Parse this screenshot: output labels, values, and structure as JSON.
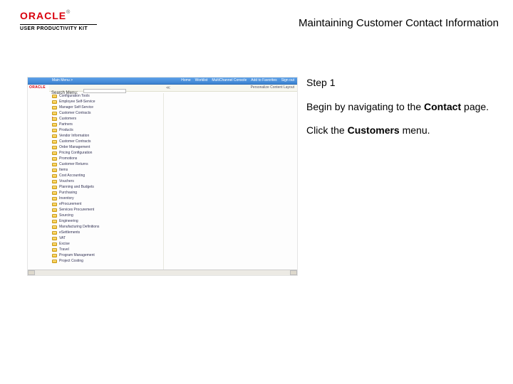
{
  "header": {
    "brand": "ORACLE",
    "trademark": "®",
    "product_line": "USER PRODUCTIVITY KIT",
    "page_title": "Maintaining Customer Contact Information"
  },
  "instructions": {
    "step_label": "Step 1",
    "line1_pre": "Begin by navigating to the ",
    "line1_bold": "Contact",
    "line1_post": " page.",
    "line2_pre": "Click the ",
    "line2_bold": "Customers",
    "line2_post": " menu."
  },
  "screenshot": {
    "brand": "ORACLE",
    "breadcrumb": "Main Menu >",
    "top_nav": [
      "Home",
      "Worklist",
      "MultiChannel Console",
      "Add to Favorites",
      "Sign out"
    ],
    "search_label": "Search Menu:",
    "collapse_icon": "≪",
    "personalize": "Personalize Content   Layout",
    "highlighted_index": 4,
    "menu_items": [
      "Configuration Tools",
      "Employee Self-Service",
      "Manager Self-Service",
      "Customer Contracts",
      "Customers",
      "Partners",
      "Products",
      "Vendor Information",
      "Customer Contracts",
      "Order Management",
      "Pricing Configuration",
      "Promotions",
      "Customer Returns",
      "Items",
      "Cost Accounting",
      "Vouchers",
      "Planning and Budgets",
      "Purchasing",
      "Inventory",
      "eProcurement",
      "Services Procurement",
      "Sourcing",
      "Engineering",
      "Manufacturing Definitions",
      "eSettlements",
      "VAT",
      "Excise",
      "Travel",
      "Program Management",
      "Project Costing"
    ]
  }
}
